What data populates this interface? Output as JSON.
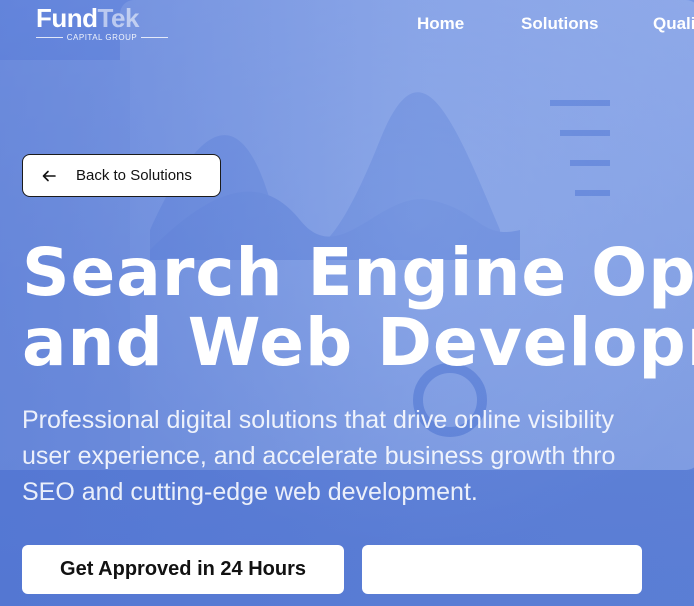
{
  "header": {
    "logo": {
      "word_main": "Fund",
      "word_accent": "Tek",
      "tagline": "CAPITAL GROUP"
    },
    "nav": [
      {
        "label": "Home"
      },
      {
        "label": "Solutions"
      },
      {
        "label": "Quali"
      }
    ]
  },
  "back_button": {
    "label": "Back to Solutions",
    "icon": "arrow-left-icon"
  },
  "hero": {
    "headline_line1": "Search Engine Opti",
    "headline_line2": "and Web Developm",
    "subtitle_line1": "Professional digital solutions that drive online visibility",
    "subtitle_line2": "user experience, and accelerate business growth thro",
    "subtitle_line3": "SEO and cutting-edge web development."
  },
  "cta": {
    "primary_label": "Get Approved in 24 Hours",
    "secondary_label": ""
  },
  "colors": {
    "hero_blue": "#6688dc",
    "text_white": "#ffffff",
    "button_text": "#111111"
  }
}
